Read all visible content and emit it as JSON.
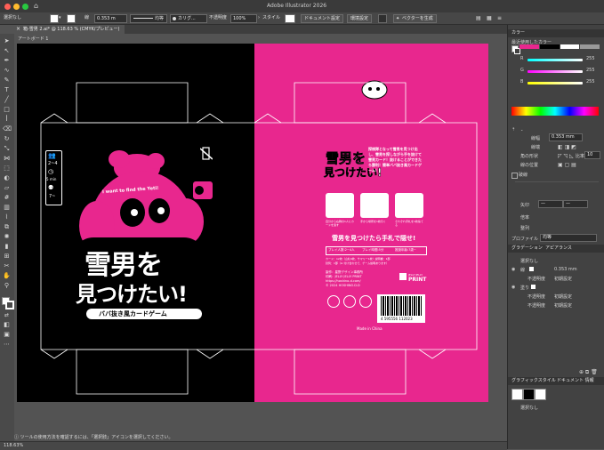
{
  "app": {
    "title": "Adobe Illustrator 2026"
  },
  "control_bar": {
    "selection_label": "選択なし",
    "stroke_label": "線",
    "stroke_weight": "0.353 m",
    "stroke_style": "均等",
    "brush_label": "カリグ...",
    "opacity_label": "不透明度",
    "opacity_value": "100%",
    "style_label": "スタイル",
    "doc_settings_button": "ドキュメント設定",
    "preferences_button": "環境設定",
    "vectorize_button": "ベクターを生成"
  },
  "document_tab": {
    "label": "箱-雪男 2.ai* @ 118.63 % (CMYK/プレビュー)"
  },
  "artboard_label": "アートボード 1",
  "artwork": {
    "left": {
      "players_text": "2~4",
      "time_text": "5 min",
      "age_text": "7~",
      "subtitle_en": "I want to find the Yeti!",
      "title_line1": "雪男を",
      "title_line2": "見つけたい!",
      "tagline": "ババ抜き風カードゲーム"
    },
    "right": {
      "logo_line1": "雪男を",
      "logo_line2": "見つけたい!",
      "description": "探検隊となって雪男を見つけ出し、雪男を探しながら手を抜けて雪男カード！抜けることができたら勝利！簡単ババ抜き風カードゲーム！",
      "step1": "自分から右隣の1人にカードを渡す",
      "step2": "手から場所を1枚引く",
      "step3": "それぞれ手札を1枚捨てる",
      "catch_phrase": "雪男を見つけたら手札で隠せ!",
      "players_label": "プレイ人数:2~4人",
      "time_label": "プレイ時間:5分",
      "age_label": "推奨年齢:7歳~",
      "contents": "カード：12枚（山札6枚、サマリー1枚）説明書：1部",
      "contents2": "封筒：1部（※ 付け合わせで、ゲーム説明あります）",
      "credits1": "製作：星野デザイン事務所",
      "credits2": "印刷：JELLY JELLY PRINT",
      "credits3": "https://hoshino-d.com/",
      "credits4": "© 2024 HOSHINO.D.D",
      "print_logo_line1": "JELLY JELLY",
      "print_logo_line2": "PRINT",
      "barcode_number": "4 595556 112023",
      "made_in": "Made in China"
    }
  },
  "status_bar": {
    "zoom": "118.63%",
    "hint": "ツールの使用方法を確認するには、「選択肢」アイコンを選択してください。"
  },
  "panels": {
    "color": {
      "header": "カラー",
      "recent_label": "最近使用したカラー",
      "r_label": "R",
      "g_label": "G",
      "b_label": "B",
      "r_value": "255",
      "g_value": "255",
      "b_value": "255"
    },
    "properties": {
      "stroke_label": "線幅",
      "stroke_value": "0.353 mm",
      "cap_label": "線端",
      "corner_label": "角の形状",
      "align_label": "線の位置",
      "limit_label": "比率",
      "limit_value": "10",
      "dashed_label": "破線",
      "arrowhead_label": "矢印",
      "scale_label": "倍率",
      "align2_label": "整列",
      "profile_label": "プロファイル",
      "profile_value": "均等"
    },
    "appearance": {
      "tab_gradient": "グラデーション",
      "tab_appearance": "アピアランス",
      "none_selected": "選択なし",
      "stroke_label": "線",
      "stroke_value": "0.353 mm",
      "opacity_label": "不透明度",
      "opacity_value": "初期設定",
      "fill_label": "塗り",
      "fill_opacity_label": "不透明度",
      "fill_opacity_value": "初期設定",
      "global_opacity_label": "不透明度",
      "global_opacity_value": "初期設定"
    },
    "graphic_styles": {
      "tab_styles": "グラフィックスタイル",
      "tab_doc": "ドキュメント 情報",
      "none_label": "選択なし"
    }
  },
  "colors": {
    "pink": "#e8278e",
    "black": "#000000",
    "ui_dark": "#424242",
    "ui_mid": "#535353"
  }
}
